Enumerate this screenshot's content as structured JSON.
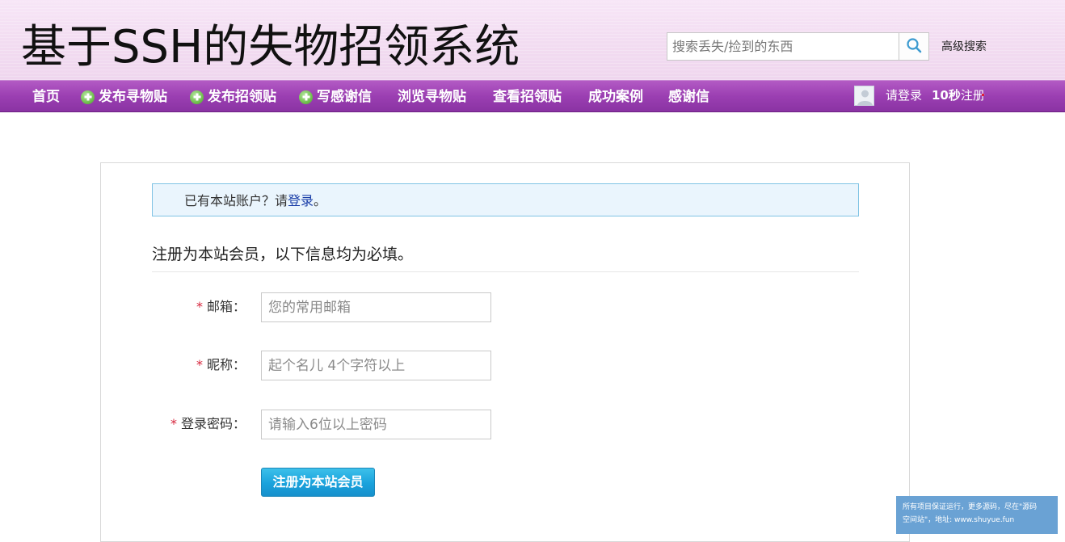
{
  "header": {
    "site_title": "基于SSH的失物招领系统",
    "search_placeholder": "搜索丢失/捡到的东西",
    "search_icon": "search-icon",
    "advanced_search": "高级搜索"
  },
  "nav": {
    "items": [
      {
        "label": "首页",
        "icon": ""
      },
      {
        "label": "发布寻物贴",
        "icon": "plus-circle-icon"
      },
      {
        "label": "发布招领贴",
        "icon": "plus-circle-icon"
      },
      {
        "label": "写感谢信",
        "icon": "plus-circle-icon"
      },
      {
        "label": "浏览寻物贴",
        "icon": ""
      },
      {
        "label": "查看招领贴",
        "icon": ""
      },
      {
        "label": "成功案例",
        "icon": ""
      },
      {
        "label": "感谢信",
        "icon": ""
      }
    ],
    "login": "请登录",
    "register_bold": "10秒",
    "register_rest": "注册"
  },
  "notice": {
    "prefix": "已有本站账户？请",
    "link": "登录",
    "suffix": "。"
  },
  "form": {
    "title": "注册为本站会员，以下信息均为必填。",
    "required_mark": "*",
    "fields": [
      {
        "label": "邮箱：",
        "placeholder": "您的常用邮箱"
      },
      {
        "label": "昵称：",
        "placeholder": "起个名儿 4个字符以上"
      },
      {
        "label": "登录密码：",
        "placeholder": "请输入6位以上密码"
      }
    ],
    "submit": "注册为本站会员"
  },
  "watermark": {
    "line1": "所有项目保证运行，更多源码，尽在\"源码",
    "line2": "空间站\"，地址: www.shuyue.fun"
  },
  "colors": {
    "nav_purple": "#9b3fb2",
    "header_pink": "#f2dcf1",
    "button_blue": "#1aa2dc",
    "required_red": "#d6243b",
    "link_blue": "#1a3ea8"
  }
}
